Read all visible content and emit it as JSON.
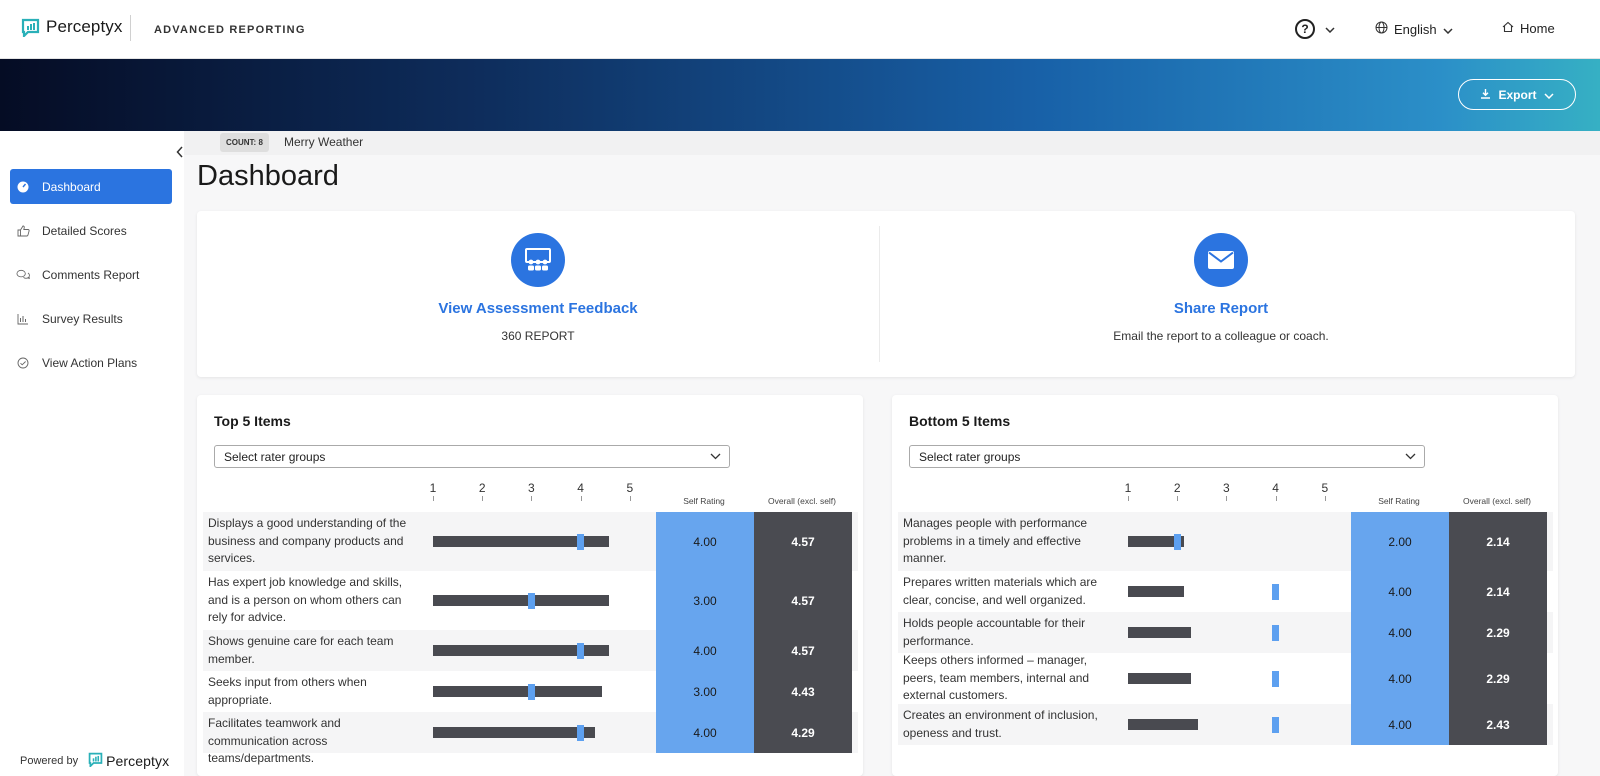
{
  "header": {
    "brand": "Perceptyx",
    "app_title": "ADVANCED REPORTING",
    "language": "English",
    "home_label": "Home",
    "help_label": "?"
  },
  "banner": {
    "export_label": "Export"
  },
  "sidebar": {
    "items": [
      {
        "label": "Dashboard",
        "icon": "dashboard-icon",
        "active": true
      },
      {
        "label": "Detailed Scores",
        "icon": "thumbs-up-icon"
      },
      {
        "label": "Comments Report",
        "icon": "comments-icon"
      },
      {
        "label": "Survey Results",
        "icon": "bar-chart-icon"
      },
      {
        "label": "View Action Plans",
        "icon": "check-circle-icon"
      }
    ],
    "powered_by": "Powered by",
    "powered_brand": "Perceptyx"
  },
  "context": {
    "count": "COUNT: 8",
    "name": "Merry Weather"
  },
  "page": {
    "title": "Dashboard"
  },
  "features": [
    {
      "title": "View Assessment Feedback",
      "subtitle": "360 REPORT",
      "icon": "team-presentation-icon"
    },
    {
      "title": "Share Report",
      "subtitle": "Email the report to a colleague or coach.",
      "icon": "envelope-icon"
    }
  ],
  "top_items": {
    "title": "Top 5 Items",
    "select_placeholder": "Select rater groups",
    "scale": [
      "1",
      "2",
      "3",
      "4",
      "5"
    ],
    "col_self": "Self Rating",
    "col_overall": "Overall (excl. self)",
    "rows": [
      {
        "label": "Displays a good understanding of the business and company products and services.",
        "self": "4.00",
        "overall": "4.57",
        "self_value": 4.0,
        "overall_value": 4.57
      },
      {
        "label": "Has expert job knowledge and skills, and is a person on whom others can rely for advice.",
        "self": "3.00",
        "overall": "4.57",
        "self_value": 3.0,
        "overall_value": 4.57
      },
      {
        "label": "Shows genuine care for each team member.",
        "self": "4.00",
        "overall": "4.57",
        "self_value": 4.0,
        "overall_value": 4.57
      },
      {
        "label": "Seeks input from others when appropriate.",
        "self": "3.00",
        "overall": "4.43",
        "self_value": 3.0,
        "overall_value": 4.43
      },
      {
        "label": "Facilitates teamwork and communication across teams/departments.",
        "self": "4.00",
        "overall": "4.29",
        "self_value": 4.0,
        "overall_value": 4.29
      }
    ]
  },
  "bottom_items": {
    "title": "Bottom 5 Items",
    "select_placeholder": "Select rater groups",
    "scale": [
      "1",
      "2",
      "3",
      "4",
      "5"
    ],
    "col_self": "Self Rating",
    "col_overall": "Overall (excl. self)",
    "rows": [
      {
        "label": "Manages people with performance problems in a timely and effective manner.",
        "self": "2.00",
        "overall": "2.14",
        "self_value": 2.0,
        "overall_value": 2.14
      },
      {
        "label": "Prepares written materials which are clear, concise, and well organized.",
        "self": "4.00",
        "overall": "2.14",
        "self_value": 4.0,
        "overall_value": 2.14
      },
      {
        "label": "Holds people accountable for their performance.",
        "self": "4.00",
        "overall": "2.29",
        "self_value": 4.0,
        "overall_value": 2.29
      },
      {
        "label": "Keeps others informed – manager, peers, team members, internal and external customers.",
        "self": "4.00",
        "overall": "2.29",
        "self_value": 4.0,
        "overall_value": 2.29
      },
      {
        "label": "Creates an environment of inclusion, openess and trust.",
        "self": "4.00",
        "overall": "2.43",
        "self_value": 4.0,
        "overall_value": 2.43
      }
    ]
  },
  "colors": {
    "accent": "#2b74e0",
    "self_rating": "#67a5ee",
    "overall": "#4a4b51",
    "marker": "#5da0f0"
  }
}
